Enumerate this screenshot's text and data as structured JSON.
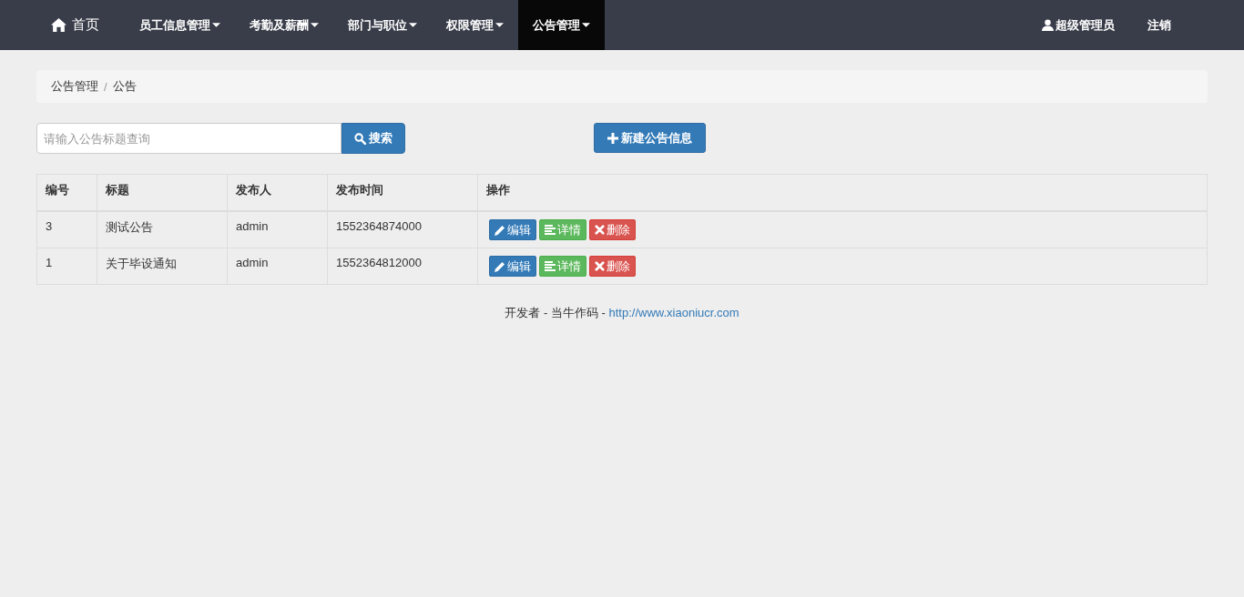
{
  "navbar": {
    "home": {
      "label": "首页"
    },
    "menus": [
      {
        "label": "员工信息管理",
        "selected": false
      },
      {
        "label": "考勤及薪酬",
        "selected": false
      },
      {
        "label": "部门与职位",
        "selected": false
      },
      {
        "label": "权限管理",
        "selected": false
      },
      {
        "label": "公告管理",
        "selected": true
      }
    ],
    "user": {
      "label": "超级管理员"
    },
    "logout": {
      "label": "注销"
    }
  },
  "breadcrumb": {
    "separator": "/",
    "items": [
      {
        "label": "公告管理"
      },
      {
        "label": "公告"
      }
    ]
  },
  "search": {
    "placeholder": "请输入公告标题查询",
    "button": "搜索"
  },
  "new_button": "新建公告信息",
  "table": {
    "columns": [
      "编号",
      "标题",
      "发布人",
      "发布时间",
      "操作"
    ],
    "rows": [
      {
        "cells": [
          "3",
          "测试公告",
          "admin",
          "1552364874000"
        ],
        "actions": [
          {
            "kind": "edit",
            "label": "编辑"
          },
          {
            "kind": "detail",
            "label": "详情"
          },
          {
            "kind": "delete",
            "label": "删除"
          }
        ]
      },
      {
        "cells": [
          "1",
          "关于毕设通知",
          "admin",
          "1552364812000"
        ],
        "actions": [
          {
            "kind": "edit",
            "label": "编辑"
          },
          {
            "kind": "detail",
            "label": "详情"
          },
          {
            "kind": "delete",
            "label": "删除"
          }
        ]
      }
    ]
  },
  "footer": {
    "text": "开发者 - 当牛作码 - ",
    "link": "http://www.xiaoniucr.com"
  }
}
